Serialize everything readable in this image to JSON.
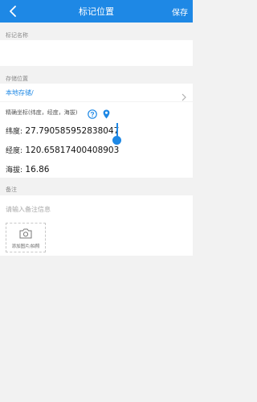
{
  "header": {
    "title": "标记位置",
    "save_label": "保存",
    "bg_color": "#1e88e5"
  },
  "name_field": {
    "label": "标记名称",
    "value": ""
  },
  "storage": {
    "label": "存储位置",
    "value": "本地存储/"
  },
  "coordinates": {
    "title": "精确坐标(纬度，经度，海拔)",
    "latitude_label": "纬度:",
    "latitude_value": "27.790585952838047",
    "longitude_label": "经度:",
    "longitude_value": "120.65817400408903",
    "altitude_label": "海拔:",
    "altitude_value": "16.86"
  },
  "notes": {
    "label": "备注",
    "placeholder": "请输入备注信息"
  },
  "upload": {
    "label": "添加图片/拍照"
  },
  "icons": {
    "back": "chevron-left-icon",
    "help": "question-circle-icon",
    "location": "location-pin-icon",
    "camera": "camera-icon",
    "chevron": "chevron-right-icon"
  }
}
